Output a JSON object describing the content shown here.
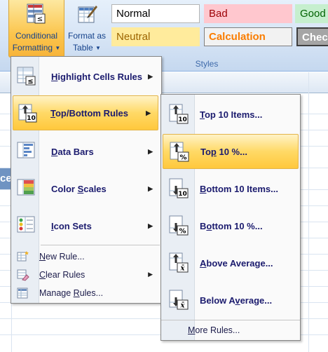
{
  "ribbon": {
    "conditional_formatting": {
      "line1": "Conditional",
      "line2": "Formatting"
    },
    "format_as_table": {
      "line1": "Format as",
      "line2": "Table"
    },
    "styles": {
      "normal": "Normal",
      "bad": "Bad",
      "good": "Good",
      "neutral": "Neutral",
      "calculation": "Calculation",
      "check": "Check"
    },
    "group_label": "Styles"
  },
  "sheet": {
    "column_fragment": "ce"
  },
  "main_menu": {
    "items": [
      {
        "label": "Highlight Cells Rules",
        "mnemonic": "H",
        "rest": "ighlight Cells Rules",
        "icon": "highlight-cells-icon"
      },
      {
        "label": "Top/Bottom Rules",
        "mnemonic": "T",
        "rest": "op/Bottom Rules",
        "icon": "top-bottom-icon"
      },
      {
        "label": "Data Bars",
        "mnemonic": "D",
        "rest": "ata Bars",
        "icon": "data-bars-icon"
      },
      {
        "label": "Color Scales",
        "mnemonic": "S",
        "pre": "Color ",
        "rest": "cales",
        "icon": "color-scales-icon"
      },
      {
        "label": "Icon Sets",
        "mnemonic": "I",
        "rest": "con Sets",
        "icon": "icon-sets-icon"
      }
    ],
    "small_items": [
      {
        "label": "New Rule...",
        "mnemonic": "N",
        "rest": "ew Rule...",
        "icon": "new-rule-icon"
      },
      {
        "label": "Clear Rules",
        "mnemonic": "C",
        "rest": "lear Rules",
        "icon": "clear-rules-icon"
      },
      {
        "label": "Manage Rules...",
        "pre": "Manage ",
        "mnemonic": "R",
        "rest": "ules...",
        "icon": "manage-rules-icon"
      }
    ]
  },
  "sub_menu": {
    "items": [
      {
        "label": "Top 10 Items...",
        "mnemonic": "T",
        "rest": "op 10 Items...",
        "icon": "top-10-items-icon",
        "glyph": "10"
      },
      {
        "label": "Top 10 %...",
        "pre": "To",
        "mnemonic": "p",
        "rest": " 10 %...",
        "icon": "top-10-percent-icon",
        "glyph": "%"
      },
      {
        "label": "Bottom 10 Items...",
        "mnemonic": "B",
        "rest": "ottom 10 Items...",
        "icon": "bottom-10-items-icon",
        "glyph": "10"
      },
      {
        "label": "Bottom 10 %...",
        "pre": "B",
        "mnemonic": "o",
        "rest": "ttom 10 %...",
        "icon": "bottom-10-percent-icon",
        "glyph": "%"
      },
      {
        "label": "Above Average...",
        "mnemonic": "A",
        "rest": "bove Average...",
        "icon": "above-average-icon",
        "glyph": "x̄"
      },
      {
        "label": "Below Average...",
        "pre": "Below A",
        "mnemonic": "v",
        "rest": "erage...",
        "icon": "below-average-icon",
        "glyph": "x̄"
      }
    ],
    "more_rules": {
      "label": "More Rules...",
      "mnemonic": "M",
      "rest": "ore Rules..."
    }
  },
  "colors": {
    "menu_text": "#1b1b6e",
    "highlight": "#ffd966",
    "ribbon_text": "#15428b"
  }
}
